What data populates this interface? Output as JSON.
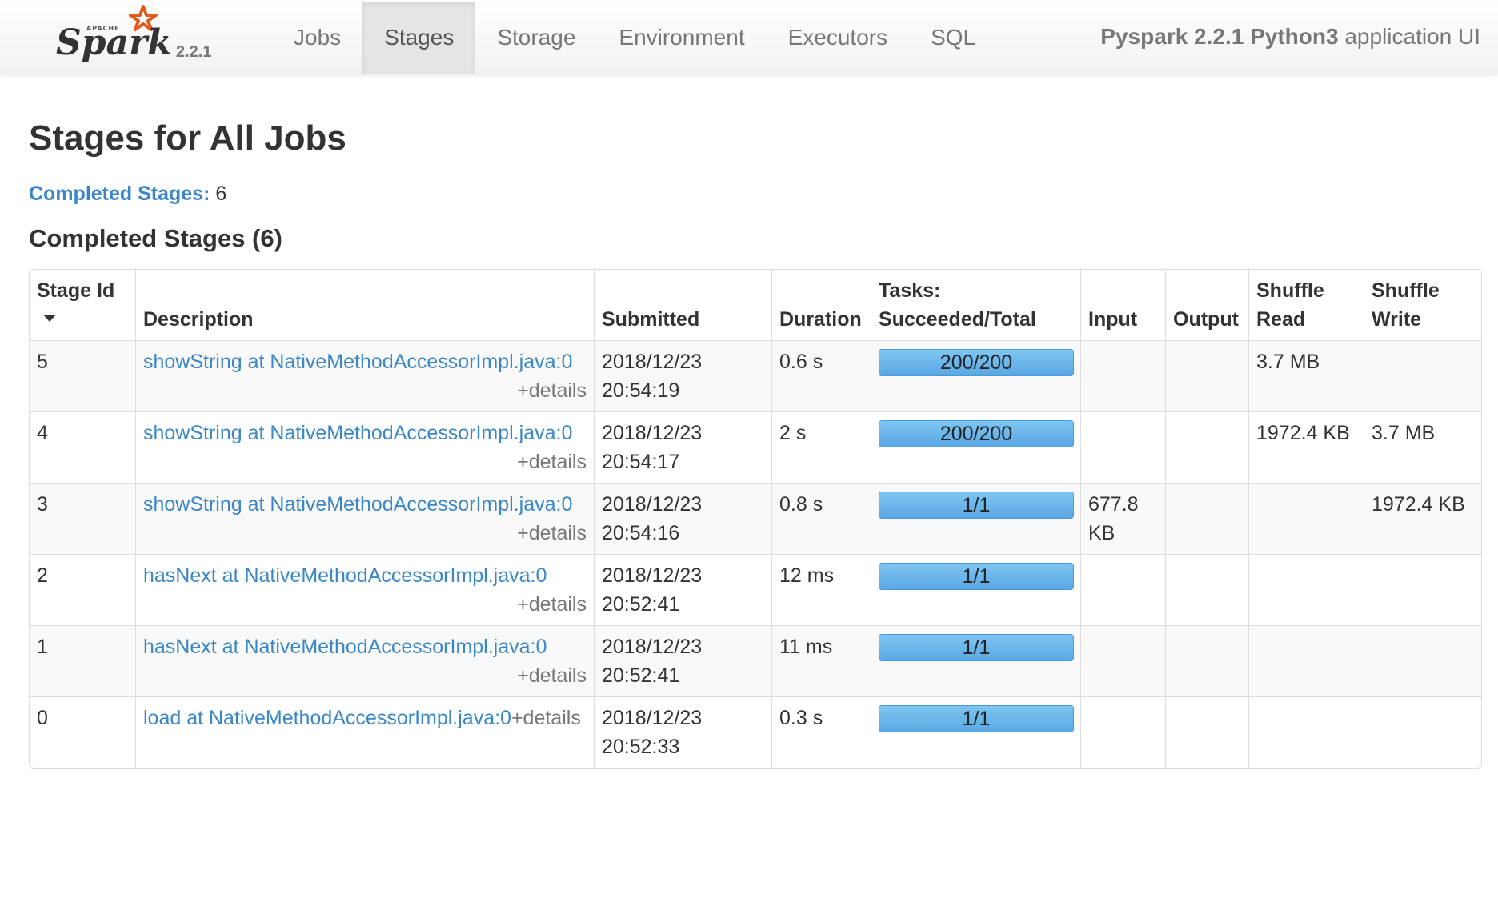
{
  "brand": {
    "logo_text": "Spark",
    "logo_small_text": "APACHE",
    "version": "2.2.1"
  },
  "nav": {
    "tabs": [
      {
        "label": "Jobs",
        "active": false
      },
      {
        "label": "Stages",
        "active": true
      },
      {
        "label": "Storage",
        "active": false
      },
      {
        "label": "Environment",
        "active": false
      },
      {
        "label": "Executors",
        "active": false
      },
      {
        "label": "SQL",
        "active": false
      }
    ],
    "app_name_bold": "Pyspark 2.2.1 Python3",
    "app_name_suffix": " application UI"
  },
  "page": {
    "title": "Stages for All Jobs",
    "summary_label": "Completed Stages:",
    "summary_count": " 6",
    "section_title": "Completed Stages (6)"
  },
  "table": {
    "headers": {
      "stage_id": "Stage Id",
      "description": "Description",
      "submitted": "Submitted",
      "duration": "Duration",
      "tasks_line1": "Tasks:",
      "tasks_line2": "Succeeded/Total",
      "input": "Input",
      "output": "Output",
      "shuffle_read_line1": "Shuffle",
      "shuffle_read_line2": "Read",
      "shuffle_write_line1": "Shuffle",
      "shuffle_write_line2": "Write"
    },
    "details_label": "+details",
    "rows": [
      {
        "stage_id": "5",
        "description": "showString at NativeMethodAccessorImpl.java:0",
        "submitted_date": "2018/12/23",
        "submitted_time": "20:54:19",
        "duration": "0.6 s",
        "tasks_label": "200/200",
        "tasks_fraction": 1.0,
        "input": "",
        "output": "",
        "shuffle_read": "3.7 MB",
        "shuffle_write": ""
      },
      {
        "stage_id": "4",
        "description": "showString at NativeMethodAccessorImpl.java:0",
        "submitted_date": "2018/12/23",
        "submitted_time": "20:54:17",
        "duration": "2 s",
        "tasks_label": "200/200",
        "tasks_fraction": 1.0,
        "input": "",
        "output": "",
        "shuffle_read": "1972.4 KB",
        "shuffle_write": "3.7 MB"
      },
      {
        "stage_id": "3",
        "description": "showString at NativeMethodAccessorImpl.java:0",
        "submitted_date": "2018/12/23",
        "submitted_time": "20:54:16",
        "duration": "0.8 s",
        "tasks_label": "1/1",
        "tasks_fraction": 1.0,
        "input": "677.8 KB",
        "output": "",
        "shuffle_read": "",
        "shuffle_write": "1972.4 KB"
      },
      {
        "stage_id": "2",
        "description": "hasNext at NativeMethodAccessorImpl.java:0",
        "submitted_date": "2018/12/23",
        "submitted_time": "20:52:41",
        "duration": "12 ms",
        "tasks_label": "1/1",
        "tasks_fraction": 1.0,
        "input": "",
        "output": "",
        "shuffle_read": "",
        "shuffle_write": ""
      },
      {
        "stage_id": "1",
        "description": "hasNext at NativeMethodAccessorImpl.java:0",
        "submitted_date": "2018/12/23",
        "submitted_time": "20:52:41",
        "duration": "11 ms",
        "tasks_label": "1/1",
        "tasks_fraction": 1.0,
        "input": "",
        "output": "",
        "shuffle_read": "",
        "shuffle_write": ""
      },
      {
        "stage_id": "0",
        "description": "load at NativeMethodAccessorImpl.java:0",
        "submitted_date": "2018/12/23",
        "submitted_time": "20:52:33",
        "duration": "0.3 s",
        "tasks_label": "1/1",
        "tasks_fraction": 1.0,
        "input": "",
        "output": "",
        "shuffle_read": "",
        "shuffle_write": ""
      }
    ]
  },
  "colors": {
    "link": "#3a87c8",
    "progress_fill": "#5aa7e3",
    "logo_star": "#e25a1c"
  }
}
